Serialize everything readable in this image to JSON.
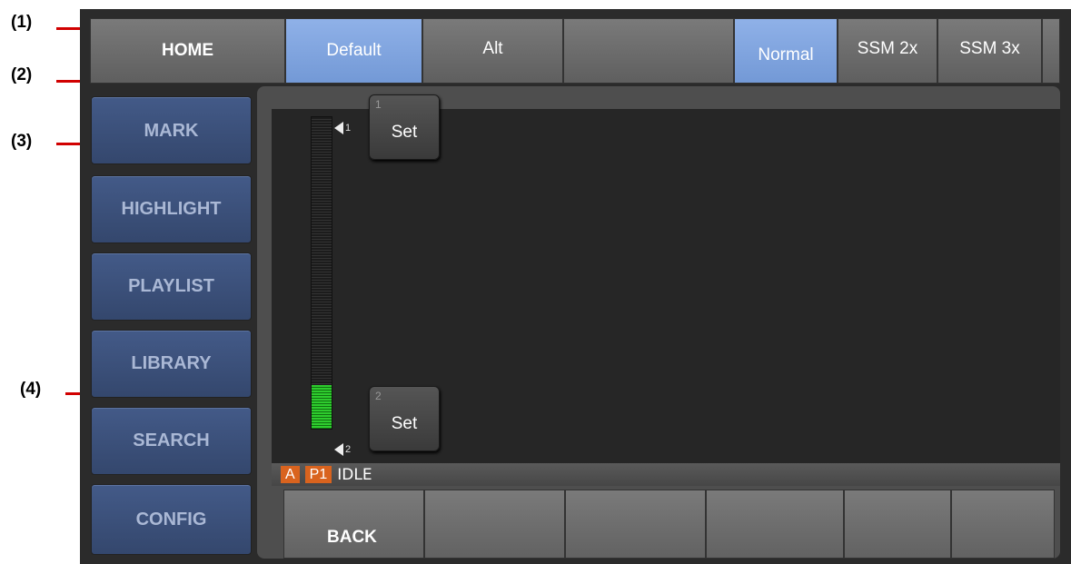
{
  "callouts": [
    "(1)",
    "(2)",
    "(3)",
    "(4)"
  ],
  "top_tabs": {
    "home": "HOME",
    "default": "Default",
    "alt": "Alt",
    "normal": "Normal",
    "ssm2x": "SSM 2x",
    "ssm3x": "SSM 3x"
  },
  "sidebar": {
    "items": [
      {
        "label": "MARK"
      },
      {
        "label": "HIGHLIGHT"
      },
      {
        "label": "PLAYLIST"
      },
      {
        "label": "LIBRARY"
      },
      {
        "label": "SEARCH"
      },
      {
        "label": "CONFIG"
      }
    ]
  },
  "set_buttons": [
    {
      "number": "1",
      "label": "Set"
    },
    {
      "number": "2",
      "label": "Set"
    }
  ],
  "meter": {
    "marker_top": "1",
    "marker_bottom": "2",
    "level": 0.14
  },
  "status": {
    "badge_a": "A",
    "badge_p": "P1",
    "text": "IDLE"
  },
  "bottom": {
    "back": "BACK"
  },
  "colors": {
    "callout_line": "#d10000",
    "selected_tab": "#7f9fdc",
    "sidebar": "#3d5280",
    "badge": "#d9631e",
    "meter_fill": "#2ecc2e"
  }
}
